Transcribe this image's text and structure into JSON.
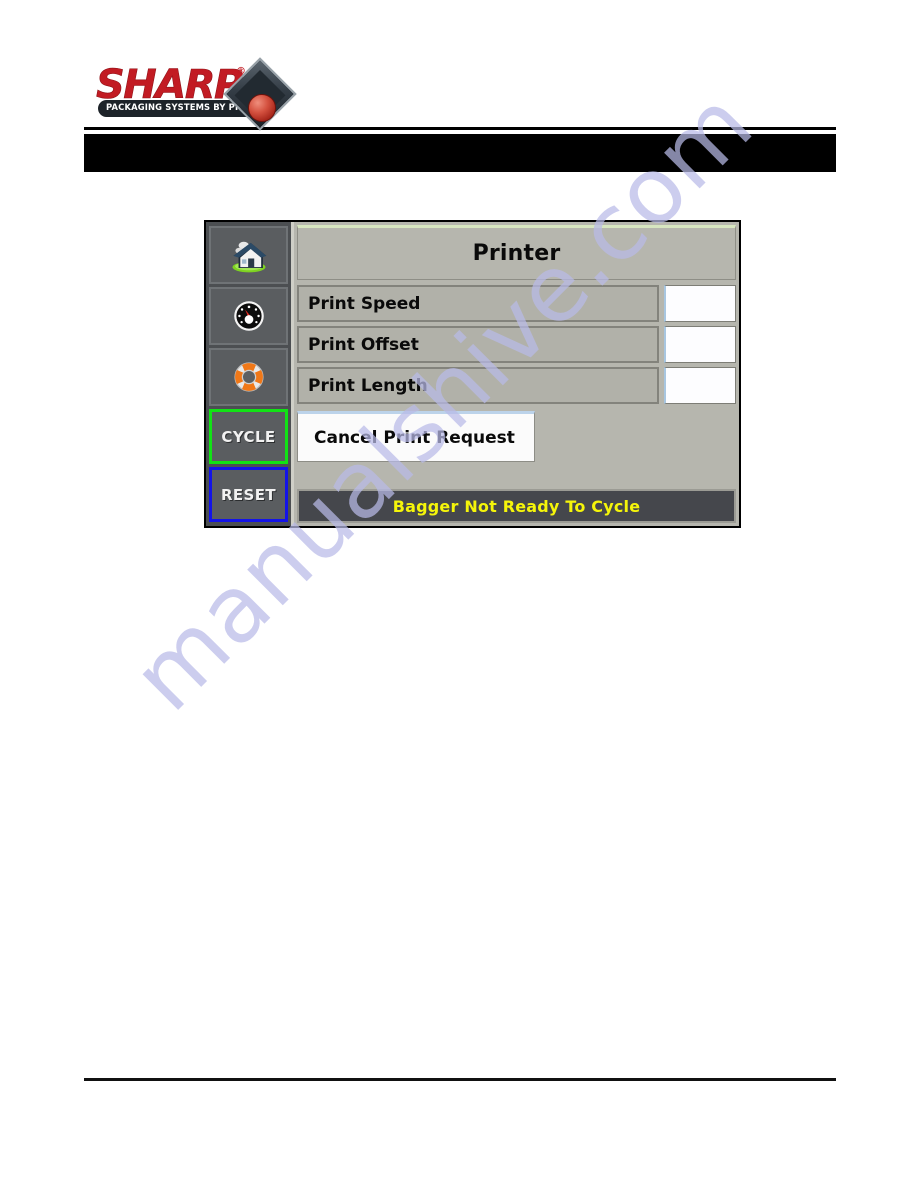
{
  "document": {
    "watermark": "manualshive.com",
    "header_banner": "",
    "footer_rule": true
  },
  "logo": {
    "brand": "SHARP",
    "registered_mark": "®",
    "tagline": "PACKAGING SYSTEMS BY PREGIS",
    "colors": {
      "brand_red": "#c21b23",
      "tagline_bar": "#1d2329",
      "diamond": "#343d46",
      "sphere": "#d4513f"
    }
  },
  "hmi": {
    "sidebar": {
      "items": [
        {
          "name": "home-icon",
          "label": ""
        },
        {
          "name": "gauge-icon",
          "label": ""
        },
        {
          "name": "life-preserver-icon",
          "label": ""
        }
      ],
      "buttons": [
        {
          "label": "CYCLE",
          "border_color": "#11e215"
        },
        {
          "label": "RESET",
          "border_color": "#1313e8"
        }
      ]
    },
    "title": "Printer",
    "rows": [
      {
        "label": "Print Speed",
        "value": ""
      },
      {
        "label": "Print Offset",
        "value": ""
      },
      {
        "label": "Print Length",
        "value": ""
      }
    ],
    "cancel_button": "Cancel Print Request",
    "status": {
      "message": "Bagger Not Ready To Cycle",
      "text_color": "#f5f50a",
      "background": "#45474c"
    }
  }
}
